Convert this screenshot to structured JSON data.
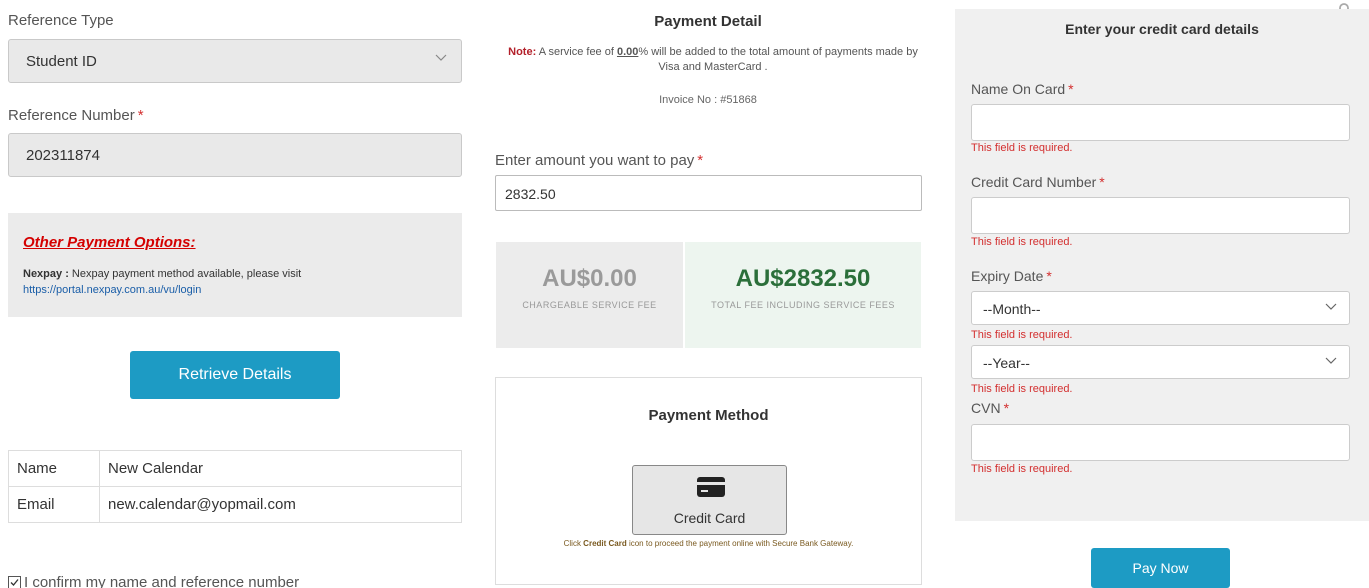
{
  "left": {
    "reference_type_label": "Reference Type",
    "reference_type_value": "Student ID",
    "reference_number_label": "Reference Number",
    "reference_number_required": "*",
    "reference_number_value": "202311874",
    "other_options_title": "Other Payment Options:",
    "nexpay_label": "Nexpay :",
    "nexpay_text": " Nexpay payment method available, please visit",
    "nexpay_link": "https://portal.nexpay.com.au/vu/login",
    "retrieve_label": "Retrieve Details",
    "info_rows": [
      {
        "key": "Name",
        "value": "New Calendar"
      },
      {
        "key": "Email",
        "value": "new.calendar@yopmail.com"
      }
    ],
    "confirm_label": "I confirm my name and reference number",
    "confirm_checked": true
  },
  "middle": {
    "title": "Payment Detail",
    "note_label": "Note:",
    "note_pre": " A service fee of ",
    "note_pct": "0.00",
    "note_post": "% will be added to the total amount of payments made by Visa and MasterCard .",
    "invoice": "Invoice No : #51868",
    "amount_label": "Enter amount you want to pay",
    "amount_required": "*",
    "amount_value": "2832.50",
    "service_fee_amount": "AU$0.00",
    "service_fee_caption": "CHARGEABLE SERVICE FEE",
    "total_fee_amount": "AU$2832.50",
    "total_fee_caption": "TOTAL FEE INCLUDING SERVICE FEES",
    "payment_method_title": "Payment Method",
    "credit_card_label": "Credit Card",
    "hint_pre": "Click ",
    "hint_bold": "Credit Card",
    "hint_post": " icon to proceed the payment online with Secure Bank Gateway."
  },
  "right": {
    "title": "Enter your credit card details",
    "required_mark": "*",
    "name_label": "Name On Card",
    "card_number_label": "Credit Card Number",
    "expiry_label": "Expiry Date",
    "month_value": "--Month--",
    "year_value": "--Year--",
    "cvn_label": "CVN",
    "error_text": "This field is required.",
    "pay_label": "Pay Now"
  },
  "colors": {
    "accent": "#1d9bc4",
    "error": "#d32f2f",
    "total_green": "#2b6f3a"
  }
}
